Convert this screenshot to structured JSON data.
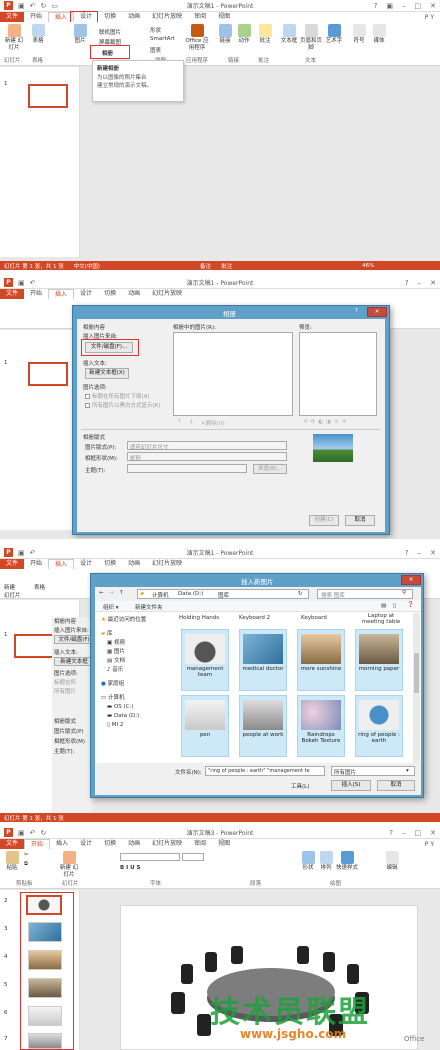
{
  "app": {
    "title1": "演示文稿1 - PowerPoint",
    "title3": "演示文稿3 - PowerPoint",
    "user": "P Y"
  },
  "menus": [
    "文件",
    "开始",
    "插入",
    "设计",
    "切换",
    "动画",
    "幻灯片放映",
    "审阅",
    "视图"
  ],
  "p1": {
    "ribbon": {
      "new_slide": "新建 幻灯片",
      "table": "表格",
      "image": "图片",
      "online_image": "联机图片",
      "screenshot": "屏幕截图",
      "album": "相册",
      "shapes": "形状",
      "smartart": "SmartArt",
      "chart": "图表",
      "office_apps": "Office 应用程序",
      "link": "链接",
      "action": "动作",
      "comment": "批注",
      "textbox": "文本框",
      "header_footer": "页眉和页脚",
      "wordart": "艺术字",
      "symbol": "符号",
      "media": "媒体"
    },
    "groups": {
      "slides": "幻灯片",
      "tables": "表格",
      "illustrations": "插图",
      "apps": "应用程序",
      "links": "链接",
      "comments": "批注",
      "text": "文本"
    },
    "dropdown": {
      "item": "新建相册",
      "tip": "为以图像的照片集合\n建立常规的演示文稿。"
    },
    "status": {
      "slide": "幻灯片 第 1 张，共 1 张",
      "lang": "中文(中国)",
      "notes": "备注",
      "comments": "批注",
      "zoom": "46%"
    },
    "slide_num": "1"
  },
  "p2": {
    "dialog_title": "相册",
    "album_content": "相册内容",
    "insert_from": "插入图片来自:",
    "file_disk": "文件/磁盘(F)...",
    "insert_text": "插入文本:",
    "new_textbox": "新建文本框(X)",
    "pic_options": "图片选项:",
    "captions": "标题在所有图片下面(A)",
    "all_bw": "所有图片以黑白方式显示(K)",
    "pics_in_album": "相册中的图片(R):",
    "preview": "预览:",
    "remove": "删除(V)",
    "layout": "相册版式",
    "pic_layout": "图片版式(P):",
    "pic_layout_val": "适应幻灯片尺寸",
    "frame_shape": "相框形状(M):",
    "frame_val": "矩形",
    "theme": "主题(T):",
    "browse": "浏览(B)...",
    "create": "创建(C)",
    "cancel": "取消",
    "slide_num": "1"
  },
  "p3": {
    "dialog_title": "插入新图片",
    "path": [
      "计算机",
      "Data (D:)",
      "图库"
    ],
    "search_placeholder": "搜索 图库",
    "organize": "组织 ▾",
    "new_folder": "新建文件夹",
    "nav": [
      "最近访问的位置",
      "库",
      "视频",
      "图片",
      "文档",
      "音乐",
      "家庭组",
      "计算机",
      "OS (C:)",
      "Data (D:)",
      "MI 2"
    ],
    "top_labels": [
      "Holding Hands",
      "Keyboard 2",
      "Keyboard",
      "Laptop at meeting table"
    ],
    "tiles": [
      {
        "label": "management team"
      },
      {
        "label": "medical doctor"
      },
      {
        "label": "more sunshine"
      },
      {
        "label": "morning paper"
      },
      {
        "label": "pen"
      },
      {
        "label": "people at work"
      },
      {
        "label": "Raindrops Bokeh Texture"
      },
      {
        "label": "ring of people : earth"
      }
    ],
    "filename_label": "文件名(N):",
    "filename_val": "\"ring of people : earth\" \"management te",
    "filetype": "所有图片",
    "tools": "工具(L)",
    "insert": "插入(S)",
    "cancel": "取消",
    "bg_left": [
      "幻灯片",
      "表格",
      "新建",
      "幻灯片"
    ],
    "bg_fields": [
      "相册内容",
      "插入图片来自:",
      "文件/磁盘(F)",
      "插入文本:",
      "新建文本框",
      "图片选项:",
      "标题在所",
      "所有图片",
      "相册版式",
      "图片版式(P)",
      "相框形状(M)",
      "主题(T):"
    ],
    "slide_num": "1",
    "status": "幻灯片 第 1 张，共 1 张"
  },
  "p4": {
    "ribbon": {
      "paste": "粘贴",
      "new_slide": "新建 幻灯片",
      "shapes": "形状",
      "arrange": "排列",
      "quick_styles": "快速样式",
      "edit": "编辑"
    },
    "groups": {
      "clipboard": "剪贴板",
      "slides": "幻灯片",
      "font": "字体",
      "paragraph": "段落",
      "drawing": "绘图"
    },
    "slide_nums": [
      "2",
      "3",
      "4",
      "5",
      "6",
      "7"
    ],
    "watermark": "技术员联盟",
    "url": "www.jsgho.com",
    "corner": "Office"
  },
  "colors": {
    "accent": "#d24726",
    "dialog": "#5fa0c8",
    "highlight": "#e03030",
    "tile": "#cde8f7"
  }
}
